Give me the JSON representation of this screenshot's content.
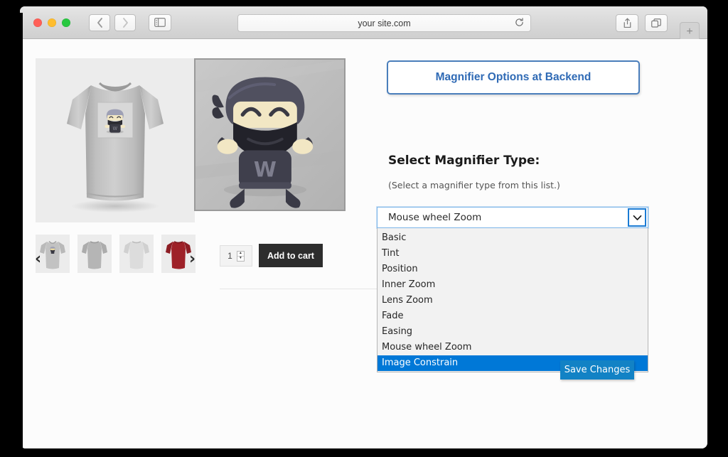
{
  "browser": {
    "url": "your site.com",
    "traffic_lights": [
      "close",
      "minimize",
      "maximize"
    ],
    "back_label": "‹",
    "forward_label": "›",
    "reload_label": "↻",
    "newtab_label": "+",
    "colors": {
      "close": "#ff5f57",
      "minimize": "#ffbd2e",
      "maximize": "#28c840"
    }
  },
  "product": {
    "quantity": "1",
    "add_to_cart_label": "Add to cart",
    "prev_arrow": "‹",
    "next_arrow": "›",
    "spinner_up": "▲",
    "spinner_down": "▼",
    "thumbnails": [
      {
        "name": "grey-shirt-front-print",
        "color": "#b9b9b9",
        "variant": "front"
      },
      {
        "name": "grey-shirt-back",
        "color": "#b0b0b0",
        "variant": "back"
      },
      {
        "name": "light-grey-shirt-back",
        "color": "#d4d4d4",
        "variant": "back"
      },
      {
        "name": "red-shirt-back",
        "color": "#9e2128",
        "variant": "back"
      }
    ]
  },
  "panel": {
    "banner_label": "Magnifier Options at Backend",
    "title": "Select Magnifier Type:",
    "hint": "(Select a magnifier type from this list.)",
    "save_label": "Save Changes",
    "accent_blue": "#2f6ab5",
    "highlight_blue": "#0078d7",
    "save_blue": "#1282c5"
  },
  "magnifier_select": {
    "selected_value": "Mouse wheel Zoom",
    "highlighted_option": "Image Constrain",
    "chevron": "⌄",
    "options": [
      "Basic",
      "Tint",
      "Position",
      "Inner Zoom",
      "Lens Zoom",
      "Fade",
      "Easing",
      "Mouse wheel Zoom",
      "Image Constrain"
    ]
  }
}
